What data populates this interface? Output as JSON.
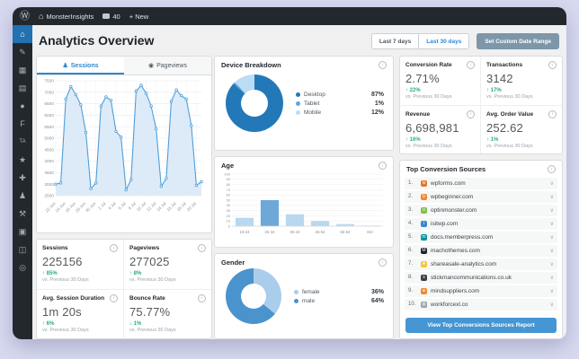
{
  "admin_bar": {
    "logo_icon": "Ⓦ",
    "home_icon": "⌂",
    "site_name": "MonsterInsights",
    "comments_count": "40",
    "new_label": "+ New"
  },
  "sidebar": {
    "items": [
      {
        "name": "dashboard",
        "glyph": "⌂",
        "active": true
      },
      {
        "name": "posts",
        "glyph": "✎",
        "active": false
      },
      {
        "name": "media",
        "glyph": "▦",
        "active": false
      },
      {
        "name": "pages",
        "glyph": "▤",
        "active": false
      },
      {
        "name": "comments",
        "glyph": "●",
        "active": false
      },
      {
        "name": "forms",
        "glyph": "F",
        "active": false
      },
      {
        "name": "ta-plugin",
        "glyph": "TA",
        "active": false
      },
      {
        "name": "appearance",
        "glyph": "★",
        "active": false
      },
      {
        "name": "plugins",
        "glyph": "✚",
        "active": false
      },
      {
        "name": "users",
        "glyph": "♟",
        "active": false
      },
      {
        "name": "tools",
        "glyph": "⚒",
        "active": false
      },
      {
        "name": "settings",
        "glyph": "▣",
        "active": false
      },
      {
        "name": "analytics",
        "glyph": "◫",
        "active": false
      },
      {
        "name": "collapse",
        "glyph": "◎",
        "active": false
      }
    ]
  },
  "header": {
    "title": "Analytics Overview",
    "range_options": [
      "Last 7 days",
      "Last 30 days"
    ],
    "active_range": "Last 30 days",
    "custom_range_label": "Set Custom Date Range"
  },
  "traffic_panel": {
    "tabs": [
      {
        "label": "Sessions",
        "icon": "♟",
        "active": true
      },
      {
        "label": "Pageviews",
        "icon": "◉",
        "active": false
      }
    ]
  },
  "chart_data": [
    {
      "id": "sessions-trend",
      "type": "area",
      "title": "Sessions",
      "x_labels": [
        "22 Jun",
        "24 Jun",
        "26 Jun",
        "28 Jun",
        "30 Jun",
        "2 Jul",
        "4 Jul",
        "6 Jul",
        "8 Jul",
        "10 Jul",
        "12 Jul",
        "14 Jul",
        "16 Jul",
        "18 Jul",
        "20 Jul"
      ],
      "values": [
        3000,
        3050,
        6700,
        7250,
        6900,
        6450,
        5250,
        2800,
        3050,
        6400,
        6800,
        6650,
        5300,
        5050,
        2750,
        3200,
        7050,
        7300,
        6950,
        6400,
        5400,
        2900,
        3250,
        6600,
        7100,
        6850,
        6700,
        5550,
        2950,
        3100
      ],
      "ylim": [
        2500,
        7500
      ],
      "ytick_step": 500,
      "grid": true,
      "line_color": "#4e9fd8",
      "fill_color": "#d9e9f8",
      "axis_text_color": "#8a9199"
    },
    {
      "id": "device-breakdown",
      "type": "pie",
      "title": "Device Breakdown",
      "segments": [
        {
          "label": "Desktop",
          "value": 87,
          "color": "#2379b8"
        },
        {
          "label": "Tablet",
          "value": 1,
          "color": "#5fa6dd"
        },
        {
          "label": "Mobile",
          "value": 12,
          "color": "#bcdcf5"
        }
      ]
    },
    {
      "id": "age",
      "type": "bar",
      "title": "Age",
      "categories": [
        "18-24",
        "25-34",
        "35-44",
        "45-54",
        "55-64",
        "65+"
      ],
      "values": [
        16,
        50,
        23,
        10,
        4,
        1
      ],
      "ylim": [
        0,
        100
      ],
      "ytick_step": 10,
      "grid": true,
      "bar_color": "#b9d8f0",
      "highlight_index": 1,
      "highlight_color": "#6ea8d8",
      "axis_text_color": "#8a9199"
    },
    {
      "id": "gender",
      "type": "pie",
      "title": "Gender",
      "segments": [
        {
          "label": "female",
          "value": 36,
          "color": "#a9cdea"
        },
        {
          "label": "male",
          "value": 64,
          "color": "#4b93cc"
        }
      ]
    }
  ],
  "summary_cards_left": [
    {
      "label": "Sessions",
      "value": "225156",
      "delta": "85%",
      "dir": "up",
      "compare": "vs. Previous 30 Days"
    },
    {
      "label": "Pageviews",
      "value": "277025",
      "delta": "8%",
      "dir": "up",
      "compare": "vs. Previous 30 Days"
    },
    {
      "label": "Avg. Session Duration",
      "value": "1m 20s",
      "delta": "6%",
      "dir": "up",
      "compare": "vs. Previous 30 Days"
    },
    {
      "label": "Bounce Rate",
      "value": "75.77%",
      "delta": "1%",
      "dir": "down",
      "compare": "vs. Previous 30 Days"
    }
  ],
  "summary_cards_right": [
    {
      "label": "Conversion Rate",
      "value": "2.71%",
      "delta": "22%",
      "dir": "up",
      "compare": "vs. Previous 30 Days"
    },
    {
      "label": "Transactions",
      "value": "3142",
      "delta": "17%",
      "dir": "up",
      "compare": "vs. Previous 30 Days"
    },
    {
      "label": "Revenue",
      "value": "6,698,981",
      "delta": "16%",
      "dir": "up",
      "compare": "vs. Previous 30 Days"
    },
    {
      "label": "Avg. Order Value",
      "value": "252.62",
      "delta": "1%",
      "dir": "up",
      "compare": "vs. Previous 30 Days"
    }
  ],
  "top_sources": {
    "title": "Top Conversion Sources",
    "items": [
      {
        "rank": "1.",
        "domain": "wpforms.com",
        "icon_color": "#e2762d",
        "icon_text": "w"
      },
      {
        "rank": "2.",
        "domain": "wpbeginner.com",
        "icon_color": "#f4862e",
        "icon_text": "b"
      },
      {
        "rank": "3.",
        "domain": "optinmonster.com",
        "icon_color": "#7ec14c",
        "icon_text": "o"
      },
      {
        "rank": "4.",
        "domain": "isitwp.com",
        "icon_color": "#3a87c8",
        "icon_text": "i"
      },
      {
        "rank": "5.",
        "domain": "docs.memberpress.com",
        "icon_color": "#01939f",
        "icon_text": "m"
      },
      {
        "rank": "6.",
        "domain": "machothemes.com",
        "icon_color": "#1f2328",
        "icon_text": "M"
      },
      {
        "rank": "7.",
        "domain": "shareasale-analytics.com",
        "icon_color": "#f3c73a",
        "icon_text": "★"
      },
      {
        "rank": "8.",
        "domain": "stickmancommunications.co.uk",
        "icon_color": "#3a3f45",
        "icon_text": "s"
      },
      {
        "rank": "9.",
        "domain": "mindsuppliers.com",
        "icon_color": "#ef8b2e",
        "icon_text": "●"
      },
      {
        "rank": "10.",
        "domain": "workforcexl.co",
        "icon_color": "#98a3ac",
        "icon_text": "◍"
      }
    ],
    "button_label": "View Top Conversions Sources Report"
  },
  "icons": {
    "up_arrow": "↑",
    "down_arrow": "↓",
    "chevron_down": "∨"
  },
  "colors": {
    "accent_blue": "#2e88d0",
    "positive_green": "#2fab7f",
    "report_button_blue": "#4596d3",
    "slate_button": "#7d96a9",
    "admin_dark": "#23282d",
    "active_menu_blue": "#2271b1"
  }
}
